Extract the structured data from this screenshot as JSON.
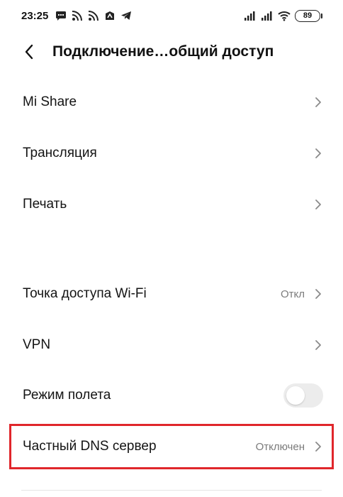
{
  "status_bar": {
    "time": "23:25",
    "left_icons": [
      "message-icon",
      "rss-icon",
      "rss-icon",
      "feed-app-icon",
      "telegram-icon"
    ],
    "right_icons": [
      "signal-bars-icon",
      "signal-bars-icon",
      "wifi-icon"
    ],
    "battery": "89"
  },
  "header": {
    "title": "Подключение…общий доступ"
  },
  "rows": [
    {
      "label": "Mi Share",
      "value": "",
      "control": "chevron"
    },
    {
      "label": "Трансляция",
      "value": "",
      "control": "chevron"
    },
    {
      "label": "Печать",
      "value": "",
      "control": "chevron"
    },
    {
      "label": "Точка доступа Wi-Fi",
      "value": "Откл",
      "control": "chevron"
    },
    {
      "label": "VPN",
      "value": "",
      "control": "chevron"
    },
    {
      "label": "Режим полета",
      "value": "",
      "control": "toggle",
      "toggle_on": false
    },
    {
      "label": "Частный DNS сервер",
      "value": "Отключен",
      "control": "chevron",
      "highlighted": true
    }
  ],
  "colors": {
    "highlight": "#e0262b",
    "chevron": "#8a8a8a",
    "secondary_text": "#7b7b7b",
    "toggle_off": "#ececec"
  }
}
